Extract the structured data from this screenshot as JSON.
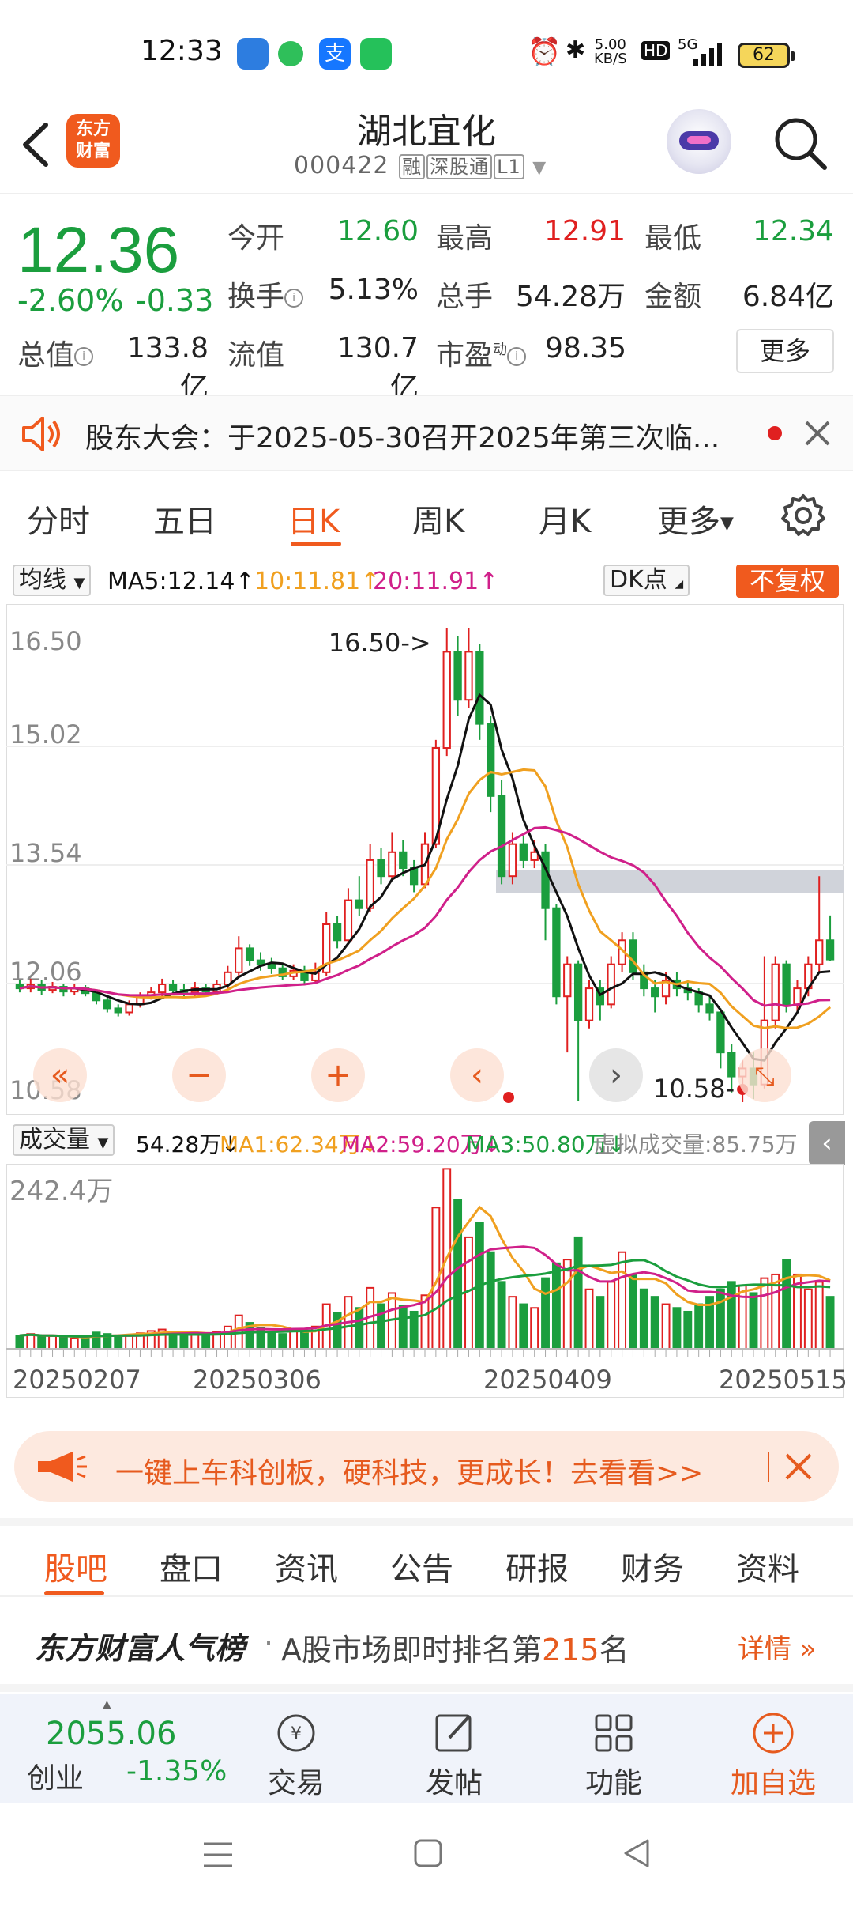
{
  "status_bar": {
    "time": "12:33",
    "net_speed_top": "5.00",
    "net_speed_unit": "KB/S",
    "hd": "HD",
    "signal": "5G",
    "battery": "62"
  },
  "header": {
    "logo_line1": "东方",
    "logo_line2": "财富",
    "stock_name": "湖北宜化",
    "stock_code": "000422",
    "tags": [
      "融",
      "深股通",
      "L1"
    ]
  },
  "quote": {
    "price": "12.36",
    "change_pct": "-2.60%",
    "change_abs": "-0.33",
    "fields": [
      {
        "label": "今开",
        "value": "12.60",
        "color": "#1b9e3e"
      },
      {
        "label": "最高",
        "value": "12.91",
        "color": "#e02020"
      },
      {
        "label": "最低",
        "value": "12.34",
        "color": "#1b9e3e"
      },
      {
        "label": "换手",
        "value": "5.13%",
        "color": "#222222"
      },
      {
        "label": "总手",
        "value": "54.28万",
        "color": "#222222"
      },
      {
        "label": "金额",
        "value": "6.84亿",
        "color": "#222222"
      },
      {
        "label": "总值",
        "value": "133.8亿",
        "color": "#222222"
      },
      {
        "label": "流值",
        "value": "130.7亿",
        "color": "#222222"
      },
      {
        "label": "市盈",
        "value": "98.35",
        "color": "#222222"
      }
    ],
    "pe_sup": "动",
    "more": "更多"
  },
  "notice": {
    "text": "股东大会：于2025-05-30召开2025年第三次临..."
  },
  "chart_tabs": [
    "分时",
    "五日",
    "日K",
    "周K",
    "月K",
    "更多"
  ],
  "ma_legend": {
    "selector": "均线",
    "ma5": "MA5:12.14",
    "ma10": "10:11.81",
    "ma20": "20:11.91",
    "dk": "DK点",
    "fq": "不复权"
  },
  "colors": {
    "up": "#e02020",
    "down": "#1b9e3e",
    "ma5": "#111111",
    "ma10": "#f0a020",
    "ma20": "#d0208a",
    "accent": "#f05a1e"
  },
  "chart_data": [
    {
      "type": "candlestick",
      "y_ticks": [
        "16.50",
        "15.02",
        "13.54",
        "12.06",
        "10.58"
      ],
      "ylim": [
        10.58,
        16.5
      ],
      "annotations": {
        "high": "16.50",
        "low": "10.58"
      },
      "x_ticks": [
        "20250207",
        "20250306",
        "20250409",
        "20250515"
      ],
      "series": [
        {
          "name": "MA5",
          "current": 12.14
        },
        {
          "name": "MA10",
          "current": 11.81
        },
        {
          "name": "MA20",
          "current": 11.91
        }
      ],
      "candles": [
        [
          12.05,
          12.0,
          12.1,
          11.95
        ],
        [
          12.0,
          12.05,
          12.12,
          11.95
        ],
        [
          12.05,
          11.98,
          12.1,
          11.92
        ],
        [
          11.98,
          12.02,
          12.08,
          11.94
        ],
        [
          12.02,
          11.96,
          12.06,
          11.9
        ],
        [
          11.96,
          12.0,
          12.05,
          11.92
        ],
        [
          12.0,
          11.94,
          12.04,
          11.9
        ],
        [
          11.94,
          11.85,
          11.98,
          11.8
        ],
        [
          11.85,
          11.75,
          11.9,
          11.7
        ],
        [
          11.75,
          11.7,
          11.8,
          11.65
        ],
        [
          11.7,
          11.8,
          11.85,
          11.66
        ],
        [
          11.8,
          11.9,
          11.95,
          11.76
        ],
        [
          11.9,
          11.95,
          12.02,
          11.86
        ],
        [
          11.95,
          12.05,
          12.12,
          11.9
        ],
        [
          12.05,
          11.98,
          12.1,
          11.92
        ],
        [
          11.98,
          11.95,
          12.05,
          11.9
        ],
        [
          11.95,
          12.0,
          12.08,
          11.9
        ],
        [
          12.0,
          11.96,
          12.05,
          11.92
        ],
        [
          11.96,
          12.05,
          12.1,
          11.92
        ],
        [
          12.05,
          12.2,
          12.28,
          12.0
        ],
        [
          12.2,
          12.5,
          12.65,
          12.15
        ],
        [
          12.5,
          12.35,
          12.55,
          12.28
        ],
        [
          12.35,
          12.3,
          12.45,
          12.22
        ],
        [
          12.3,
          12.25,
          12.38,
          12.18
        ],
        [
          12.25,
          12.15,
          12.3,
          12.1
        ],
        [
          12.15,
          12.22,
          12.3,
          12.1
        ],
        [
          12.22,
          12.1,
          12.28,
          12.05
        ],
        [
          12.1,
          12.2,
          12.32,
          12.05
        ],
        [
          12.2,
          12.8,
          12.95,
          12.15
        ],
        [
          12.8,
          12.6,
          12.9,
          12.5
        ],
        [
          12.6,
          13.1,
          13.25,
          12.55
        ],
        [
          13.1,
          13.0,
          13.4,
          12.9
        ],
        [
          13.0,
          13.6,
          13.8,
          12.95
        ],
        [
          13.6,
          13.4,
          13.75,
          13.3
        ],
        [
          13.4,
          13.7,
          13.95,
          13.35
        ],
        [
          13.7,
          13.5,
          13.85,
          13.4
        ],
        [
          13.5,
          13.3,
          13.6,
          13.2
        ],
        [
          13.3,
          13.8,
          13.95,
          13.25
        ],
        [
          13.8,
          15.0,
          15.1,
          13.75
        ],
        [
          15.0,
          16.2,
          16.5,
          14.9
        ],
        [
          16.2,
          15.6,
          16.4,
          15.4
        ],
        [
          15.6,
          16.2,
          16.5,
          15.5
        ],
        [
          16.2,
          15.3,
          16.3,
          15.1
        ],
        [
          15.3,
          14.4,
          15.4,
          14.2
        ],
        [
          14.4,
          13.4,
          14.6,
          13.3
        ],
        [
          13.4,
          13.8,
          13.95,
          13.3
        ],
        [
          13.8,
          13.6,
          13.9,
          13.5
        ],
        [
          13.6,
          13.7,
          13.85,
          13.5
        ],
        [
          13.7,
          13.0,
          13.8,
          12.6
        ],
        [
          13.0,
          11.9,
          13.05,
          11.8
        ],
        [
          11.9,
          12.3,
          12.4,
          11.2
        ],
        [
          12.3,
          11.6,
          12.35,
          10.6
        ],
        [
          11.6,
          12.0,
          12.1,
          11.5
        ],
        [
          12.0,
          11.8,
          12.1,
          11.6
        ],
        [
          11.8,
          12.3,
          12.4,
          11.75
        ],
        [
          12.3,
          12.6,
          12.7,
          12.2
        ],
        [
          12.6,
          12.2,
          12.7,
          12.1
        ],
        [
          12.2,
          12.0,
          12.3,
          11.9
        ],
        [
          12.0,
          11.9,
          12.1,
          11.7
        ],
        [
          11.9,
          12.1,
          12.2,
          11.8
        ],
        [
          12.1,
          12.0,
          12.2,
          11.9
        ],
        [
          12.0,
          11.95,
          12.1,
          11.85
        ],
        [
          11.95,
          11.8,
          12.0,
          11.7
        ],
        [
          11.8,
          11.7,
          11.9,
          11.6
        ],
        [
          11.7,
          11.2,
          11.75,
          11.0
        ],
        [
          11.2,
          10.9,
          11.3,
          10.7
        ],
        [
          10.9,
          11.0,
          11.1,
          10.58
        ],
        [
          11.0,
          10.8,
          11.2,
          10.62
        ],
        [
          10.8,
          11.6,
          12.4,
          10.75
        ],
        [
          11.6,
          12.3,
          12.4,
          11.5
        ],
        [
          12.3,
          11.8,
          12.35,
          11.7
        ],
        [
          11.8,
          12.0,
          12.1,
          11.7
        ],
        [
          12.0,
          12.3,
          12.4,
          11.9
        ],
        [
          12.3,
          12.6,
          13.4,
          12.2
        ],
        [
          12.6,
          12.36,
          12.91,
          12.34
        ]
      ]
    },
    {
      "type": "bar",
      "title": "成交量",
      "y_ticks": [
        "242.4万"
      ],
      "ylim": [
        0,
        242.4
      ],
      "series": [
        {
          "name": "MA1",
          "current": 62.34
        },
        {
          "name": "MA2",
          "current": 59.2
        },
        {
          "name": "MA3",
          "current": 50.8
        }
      ],
      "values": [
        18,
        20,
        16,
        17,
        15,
        14,
        16,
        22,
        20,
        18,
        19,
        21,
        24,
        26,
        22,
        18,
        20,
        19,
        23,
        30,
        45,
        35,
        28,
        22,
        20,
        24,
        22,
        30,
        60,
        48,
        70,
        55,
        82,
        60,
        75,
        58,
        50,
        72,
        190,
        242,
        200,
        150,
        170,
        130,
        90,
        70,
        60,
        55,
        95,
        115,
        120,
        150,
        80,
        70,
        90,
        130,
        100,
        80,
        70,
        60,
        55,
        50,
        60,
        70,
        80,
        90,
        85,
        75,
        95,
        100,
        120,
        100,
        80,
        90,
        70
      ],
      "up": [
        0,
        1,
        0,
        1,
        0,
        1,
        0,
        0,
        0,
        0,
        1,
        1,
        1,
        1,
        0,
        0,
        1,
        0,
        1,
        1,
        1,
        0,
        0,
        0,
        0,
        1,
        0,
        1,
        1,
        0,
        1,
        0,
        1,
        0,
        1,
        0,
        0,
        1,
        1,
        1,
        0,
        1,
        0,
        0,
        0,
        1,
        0,
        1,
        0,
        0,
        1,
        0,
        1,
        0,
        1,
        1,
        0,
        0,
        0,
        1,
        0,
        0,
        0,
        0,
        0,
        0,
        1,
        0,
        1,
        1,
        0,
        1,
        1,
        1,
        0
      ]
    }
  ],
  "vol_legend": {
    "selector": "成交量",
    "current": "54.28万",
    "ma1": "MA1:62.34万",
    "ma2": "MA2:59.20万",
    "ma3": "MA3:50.80万",
    "virtual": "虚拟成交量:85.75万"
  },
  "promo": {
    "text": "一键上车科创板，硬科技，更成长！去看看>>"
  },
  "bottom_tabs": [
    "股吧",
    "盘口",
    "资讯",
    "公告",
    "研报",
    "财务",
    "资料"
  ],
  "ranking": {
    "brand": "东方财富人气榜",
    "text_prefix": "A股市场即时排名第",
    "rank": "215",
    "text_suffix": "名",
    "detail": "详情"
  },
  "toolbar": {
    "index_value": "2055.06",
    "index_name": "创业",
    "index_change": "-1.35%",
    "items": [
      "交易",
      "发帖",
      "功能",
      "加自选"
    ]
  }
}
